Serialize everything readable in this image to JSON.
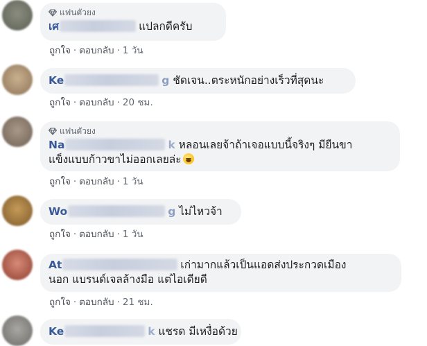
{
  "comments": [
    {
      "badge": "แฟนตัวยง",
      "author_visible": "เศ",
      "text": "แปลกดีครับ",
      "like": "ถูกใจ",
      "reply": "ตอบกลับ",
      "time": "1 วัน",
      "avatar_color": "#6f7266"
    },
    {
      "author_visible": "Ke",
      "author_tail": "g",
      "text": "ชัดเจน..ตระหนักอย่างเร็วที่สุดนะ",
      "like": "ถูกใจ",
      "reply": "ตอบกลับ",
      "time": "20 ชม.",
      "avatar_color": "#b49a7a"
    },
    {
      "badge": "แฟนตัวยง",
      "author_visible": "Na",
      "author_tail": "k",
      "text": "หลอนเลยจ้าถ้าเจอแบบนี้จริงๆ มียืนขา",
      "text2": "แข็งแบบก้าวขาไม่ออกเลยล่ะ",
      "like": "ถูกใจ",
      "reply": "ตอบกลับ",
      "time": "1 วัน",
      "avatar_color": "#8c7d70"
    },
    {
      "author_visible": "Wo",
      "author_tail": "g",
      "text": "ไม่ไหวจ้า",
      "like": "ถูกใจ",
      "reply": "ตอบกลับ",
      "time": "1 วัน",
      "avatar_color": "#a0783c"
    },
    {
      "author_visible": "At",
      "text": "เก่ามากแล้วเป็นแอดส่งประกวดเมือง",
      "text2": "นอก แบรนด์เจลล้างมือ แต่ไอเดียดี",
      "like": "ถูกใจ",
      "reply": "ตอบกลับ",
      "time": "21 ชม.",
      "avatar_color": "#b9604f"
    },
    {
      "author_visible": "Ke",
      "author_tail": "k",
      "text": "แชรด มีเหงื่อด้วย",
      "avatar_color": "#8b8a86"
    }
  ],
  "separator": "·",
  "colors": {
    "bubble": "#f2f3f5",
    "author": "#385898",
    "meta": "#606770",
    "text": "#1c1e21"
  }
}
